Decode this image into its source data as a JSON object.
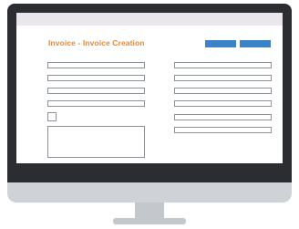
{
  "screen": {
    "title": "Invoice - Invoice Creation",
    "title_color": "#e6893b",
    "topbar_color": "#e9e6ee",
    "button_color": "#3a83c9",
    "frame_color": "#2b2d31",
    "stand_color": "#cfd2d6"
  },
  "form": {
    "left_fields": [
      "",
      "",
      "",
      ""
    ],
    "right_fields": [
      "",
      "",
      "",
      "",
      "",
      ""
    ],
    "checkbox_checked": false,
    "notes": ""
  },
  "toolbar": {
    "primary_button_label": "",
    "secondary_button_label": ""
  }
}
